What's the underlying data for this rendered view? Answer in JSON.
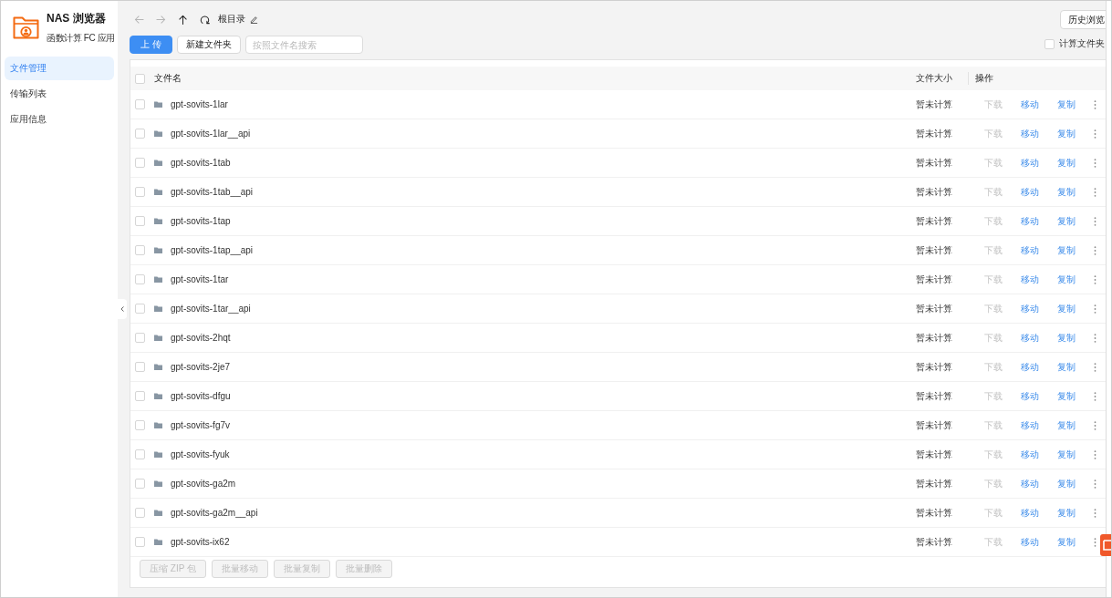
{
  "app": {
    "title": "NAS 浏览器",
    "subtitle": "函数计算 FC 应用"
  },
  "sidebar": {
    "items": [
      {
        "label": "文件管理",
        "selected": true
      },
      {
        "label": "传输列表",
        "selected": false
      },
      {
        "label": "应用信息",
        "selected": false
      }
    ]
  },
  "toolbar": {
    "nav_buttons": [
      {
        "kind": "back",
        "disabled": true
      },
      {
        "kind": "forward",
        "disabled": true
      },
      {
        "kind": "up",
        "disabled": false
      },
      {
        "kind": "refresh",
        "disabled": false
      }
    ],
    "path": "根目录",
    "upload_button": "上 传",
    "new_folder_button": "新建文件夹",
    "search": {
      "placeholder": "按照文件名搜索"
    },
    "history_button": "历史浏览",
    "calc_folder_size": {
      "label": "计算文件夹",
      "checked": false
    }
  },
  "table": {
    "select_all": {
      "checked": false
    },
    "columns": [
      "文件名",
      "文件大小",
      "操作"
    ],
    "rows": [
      {
        "name": "gpt-sovits-1lar",
        "size": "暂未计算",
        "checked": false,
        "actions": [
          {
            "label": "下载",
            "disabled": true
          },
          {
            "label": "移动",
            "disabled": false
          },
          {
            "label": "复制",
            "disabled": false
          }
        ]
      },
      {
        "name": "gpt-sovits-1lar__api",
        "size": "暂未计算",
        "checked": false,
        "actions": [
          {
            "label": "下载",
            "disabled": true
          },
          {
            "label": "移动",
            "disabled": false
          },
          {
            "label": "复制",
            "disabled": false
          }
        ]
      },
      {
        "name": "gpt-sovits-1tab",
        "size": "暂未计算",
        "checked": false,
        "actions": [
          {
            "label": "下载",
            "disabled": true
          },
          {
            "label": "移动",
            "disabled": false
          },
          {
            "label": "复制",
            "disabled": false
          }
        ]
      },
      {
        "name": "gpt-sovits-1tab__api",
        "size": "暂未计算",
        "checked": false,
        "actions": [
          {
            "label": "下载",
            "disabled": true
          },
          {
            "label": "移动",
            "disabled": false
          },
          {
            "label": "复制",
            "disabled": false
          }
        ]
      },
      {
        "name": "gpt-sovits-1tap",
        "size": "暂未计算",
        "checked": false,
        "actions": [
          {
            "label": "下载",
            "disabled": true
          },
          {
            "label": "移动",
            "disabled": false
          },
          {
            "label": "复制",
            "disabled": false
          }
        ]
      },
      {
        "name": "gpt-sovits-1tap__api",
        "size": "暂未计算",
        "checked": false,
        "actions": [
          {
            "label": "下载",
            "disabled": true
          },
          {
            "label": "移动",
            "disabled": false
          },
          {
            "label": "复制",
            "disabled": false
          }
        ]
      },
      {
        "name": "gpt-sovits-1tar",
        "size": "暂未计算",
        "checked": false,
        "actions": [
          {
            "label": "下载",
            "disabled": true
          },
          {
            "label": "移动",
            "disabled": false
          },
          {
            "label": "复制",
            "disabled": false
          }
        ]
      },
      {
        "name": "gpt-sovits-1tar__api",
        "size": "暂未计算",
        "checked": false,
        "actions": [
          {
            "label": "下载",
            "disabled": true
          },
          {
            "label": "移动",
            "disabled": false
          },
          {
            "label": "复制",
            "disabled": false
          }
        ]
      },
      {
        "name": "gpt-sovits-2hqt",
        "size": "暂未计算",
        "checked": false,
        "actions": [
          {
            "label": "下载",
            "disabled": true
          },
          {
            "label": "移动",
            "disabled": false
          },
          {
            "label": "复制",
            "disabled": false
          }
        ]
      },
      {
        "name": "gpt-sovits-2je7",
        "size": "暂未计算",
        "checked": false,
        "actions": [
          {
            "label": "下载",
            "disabled": true
          },
          {
            "label": "移动",
            "disabled": false
          },
          {
            "label": "复制",
            "disabled": false
          }
        ]
      },
      {
        "name": "gpt-sovits-dfgu",
        "size": "暂未计算",
        "checked": false,
        "actions": [
          {
            "label": "下载",
            "disabled": true
          },
          {
            "label": "移动",
            "disabled": false
          },
          {
            "label": "复制",
            "disabled": false
          }
        ]
      },
      {
        "name": "gpt-sovits-fg7v",
        "size": "暂未计算",
        "checked": false,
        "actions": [
          {
            "label": "下载",
            "disabled": true
          },
          {
            "label": "移动",
            "disabled": false
          },
          {
            "label": "复制",
            "disabled": false
          }
        ]
      },
      {
        "name": "gpt-sovits-fyuk",
        "size": "暂未计算",
        "checked": false,
        "actions": [
          {
            "label": "下载",
            "disabled": true
          },
          {
            "label": "移动",
            "disabled": false
          },
          {
            "label": "复制",
            "disabled": false
          }
        ]
      },
      {
        "name": "gpt-sovits-ga2m",
        "size": "暂未计算",
        "checked": false,
        "actions": [
          {
            "label": "下载",
            "disabled": true
          },
          {
            "label": "移动",
            "disabled": false
          },
          {
            "label": "复制",
            "disabled": false
          }
        ]
      },
      {
        "name": "gpt-sovits-ga2m__api",
        "size": "暂未计算",
        "checked": false,
        "actions": [
          {
            "label": "下载",
            "disabled": true
          },
          {
            "label": "移动",
            "disabled": false
          },
          {
            "label": "复制",
            "disabled": false
          }
        ]
      },
      {
        "name": "gpt-sovits-ix62",
        "size": "暂未计算",
        "checked": false,
        "actions": [
          {
            "label": "下载",
            "disabled": true
          },
          {
            "label": "移动",
            "disabled": false
          },
          {
            "label": "复制",
            "disabled": false
          }
        ]
      }
    ]
  },
  "bulk_actions": [
    {
      "label": "压缩 ZIP 包",
      "disabled": true
    },
    {
      "label": "批量移动",
      "disabled": true
    },
    {
      "label": "批量复制",
      "disabled": true
    },
    {
      "label": "批量删除",
      "disabled": true
    }
  ]
}
